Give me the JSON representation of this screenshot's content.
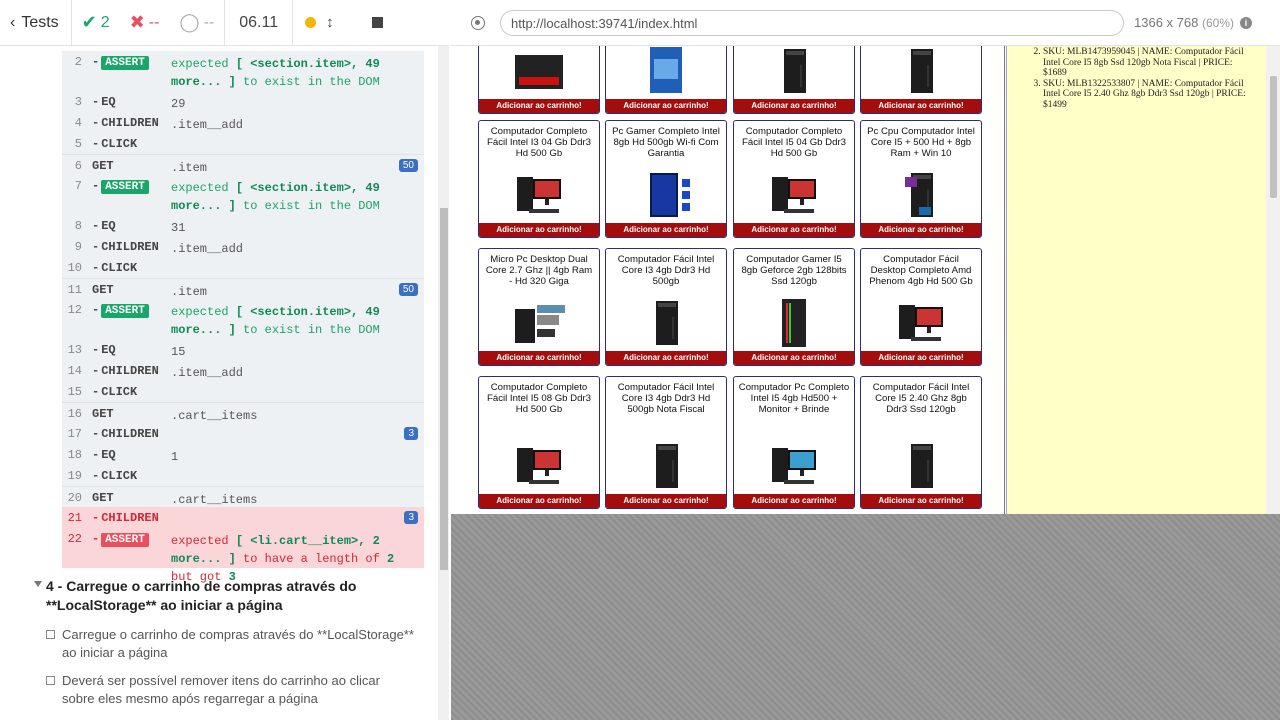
{
  "reporter": {
    "tests_label": "Tests",
    "passed": "2",
    "failed": "--",
    "pending": "--",
    "duration": "06.11"
  },
  "commands": [
    {
      "n": "2",
      "name": "ASSERT",
      "assert": true,
      "msg_pre": "expected ",
      "msg_b": "[ <section.item>, 49 more... ]",
      "msg_post": " to exist in the DOM"
    },
    {
      "n": "3",
      "name": "EQ",
      "msg": "29"
    },
    {
      "n": "4",
      "name": "CHILDREN",
      "msg": ".item__add"
    },
    {
      "n": "5",
      "name": "CLICK",
      "msg": ""
    },
    {
      "n": "6",
      "name": "GET",
      "msg": ".item",
      "count": "50"
    },
    {
      "n": "7",
      "name": "ASSERT",
      "assert": true,
      "msg_pre": "expected ",
      "msg_b": "[ <section.item>, 49 more... ]",
      "msg_post": " to exist in the DOM"
    },
    {
      "n": "8",
      "name": "EQ",
      "msg": "31"
    },
    {
      "n": "9",
      "name": "CHILDREN",
      "msg": ".item__add"
    },
    {
      "n": "10",
      "name": "CLICK",
      "msg": ""
    },
    {
      "n": "11",
      "name": "GET",
      "msg": ".item",
      "count": "50"
    },
    {
      "n": "12",
      "name": "ASSERT",
      "assert": true,
      "msg_pre": "expected ",
      "msg_b": "[ <section.item>, 49 more... ]",
      "msg_post": " to exist in the DOM"
    },
    {
      "n": "13",
      "name": "EQ",
      "msg": "15"
    },
    {
      "n": "14",
      "name": "CHILDREN",
      "msg": ".item__add"
    },
    {
      "n": "15",
      "name": "CLICK",
      "msg": ""
    },
    {
      "n": "16",
      "name": "GET",
      "msg": ".cart__items"
    },
    {
      "n": "17",
      "name": "CHILDREN",
      "msg": "",
      "count": "3"
    },
    {
      "n": "18",
      "name": "EQ",
      "msg": "1"
    },
    {
      "n": "19",
      "name": "CLICK",
      "msg": ""
    },
    {
      "n": "20",
      "name": "GET",
      "msg": ".cart__items"
    },
    {
      "n": "21",
      "name": "CHILDREN",
      "msg": "",
      "count": "3",
      "error": true
    },
    {
      "n": "22",
      "name": "ASSERT",
      "assert": true,
      "error": true,
      "msg_pre": "expected ",
      "msg_b": "[ <li.cart__item>, 2 more... ]",
      "msg_post": " to have a length of ",
      "msg_b2": "2",
      "msg_post2": " but got ",
      "msg_b3": "3"
    }
  ],
  "suite": {
    "title": "4 - Carregue o carrinho de compras através do **LocalStorage** ao iniciar a página",
    "tests": [
      "Carregue o carrinho de compras através do **LocalStorage** ao iniciar a página",
      "Deverá ser possível remover itens do carrinho ao clicar sobre eles mesmo após regarregar a página"
    ]
  },
  "aut": {
    "url": "http://localhost:39741/index.html",
    "viewport": "1366 x 768",
    "scale": "(60%)"
  },
  "products": [
    {
      "title": "",
      "img": "ssd"
    },
    {
      "title": "",
      "img": "i3"
    },
    {
      "title": "",
      "img": "tower"
    },
    {
      "title": "",
      "img": "tower"
    },
    {
      "title": "Computador Completo Fácil Intel I3 04 Gb Ddr3 Hd 500 Gb",
      "img": "pc-monitor"
    },
    {
      "title": "Pc Gamer Completo Intel 8gb Hd 500gb Wi-fi Com Garantia",
      "img": "gamer"
    },
    {
      "title": "Computador Completo Fácil Intel I5 04 Gb Ddr3 Hd 500 Gb",
      "img": "pc-monitor"
    },
    {
      "title": "Pc Cpu Computador Intel Core I5 + 500 Hd + 8gb Ram + Win 10",
      "img": "tower-stickers"
    },
    {
      "title": "Micro Pc Desktop Dual Core 2.7 Ghz || 4gb Ram - Hd 320 Giga",
      "img": "micro"
    },
    {
      "title": "Computador Fácil Intel Core I3 4gb Ddr3 Hd 500gb",
      "img": "tower"
    },
    {
      "title": "Computador Gamer I5 8gb Geforce 2gb 128bits Ssd 120gb",
      "img": "rgb"
    },
    {
      "title": "Computador Fácil Desktop Completo Amd Phenom 4gb Hd 500 Gb",
      "img": "pc-monitor"
    },
    {
      "title": "Computador Completo Fácil Intel I5 08 Gb Ddr3 Hd 500 Gb",
      "img": "pc-monitor"
    },
    {
      "title": "Computador Fácil Intel Core I3 4gb Ddr3 Hd 500gb Nota Fiscal",
      "img": "tower"
    },
    {
      "title": "Computador Pc Completo Intel I5 4gb Hd500 + Monitor + Brinde",
      "img": "pc-monitor2"
    },
    {
      "title": "Computador Fácil Intel Core I5 2.40 Ghz 8gb Ddr3 Ssd 120gb",
      "img": "tower"
    }
  ],
  "add_to_cart_label": "Adicionar ao carrinho!",
  "cart_items": [
    "SKU: MLB1473959045 | NAME: Computador Fácil Intel Core I5 8gb Ssd 120gb Nota Fiscal | PRICE: $1689",
    "SKU: MLB1322533807 | NAME: Computador Fácil Intel Core I5 2.40 Ghz 8gb Ddr3 Ssd 120gb | PRICE: $1499"
  ],
  "colors": {
    "pass": "#1aa56a",
    "fail": "#e94f5f",
    "button": "#a50d0d",
    "cart_bg": "#ffffc8"
  }
}
